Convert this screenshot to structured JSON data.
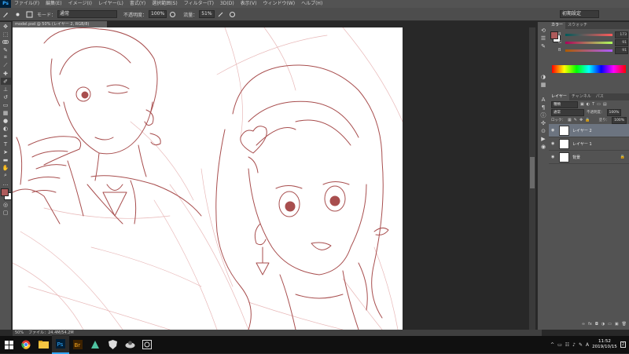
{
  "app": {
    "logo": "Ps"
  },
  "menu": [
    "ファイル(F)",
    "編集(E)",
    "イメージ(I)",
    "レイヤー(L)",
    "書式(Y)",
    "選択範囲(S)",
    "フィルター(T)",
    "3D(D)",
    "表示(V)",
    "ウィンドウ(W)",
    "ヘルプ(H)"
  ],
  "options": {
    "mode_label": "モード：",
    "mode_value": "通常",
    "opacity_label": "不透明度：",
    "opacity_value": "100%",
    "flow_label": "流量：",
    "flow_value": "51%",
    "workspace": "初期設定"
  },
  "document": {
    "tab_title": "model.psd @ 50% (レイヤー 2, RGB/8)",
    "zoom": "50%",
    "file_info": "ファイル：24.4M/54.2M"
  },
  "color_panel": {
    "tabs": [
      "カラー",
      "スウォッチ"
    ],
    "channels": [
      {
        "name": "R",
        "value": "173"
      },
      {
        "name": "G",
        "value": "91"
      },
      {
        "name": "B",
        "value": "91"
      }
    ],
    "foreground_color": "#ad5b5b",
    "background_color": "#ffffff"
  },
  "layers_panel": {
    "tabs": [
      "レイヤー",
      "チャンネル",
      "パス"
    ],
    "filter_value": "種類",
    "blend_mode": "通常",
    "opacity_label": "不透明度：",
    "opacity_value": "100%",
    "lock_label": "ロック：",
    "fill_label": "塗り：",
    "fill_value": "100%",
    "layers": [
      {
        "name": "レイヤー 2",
        "selected": true
      },
      {
        "name": "レイヤー 1",
        "selected": false
      },
      {
        "name": "背景",
        "selected": false,
        "locked": true
      }
    ]
  },
  "taskbar": {
    "time": "11:52",
    "date": "2019/10/15",
    "ime": "A",
    "notification_count": "2"
  },
  "colors": {
    "sketch": "#a84e4e",
    "sketch_light": "#e8b8b8",
    "accent": "#31a8ff"
  }
}
